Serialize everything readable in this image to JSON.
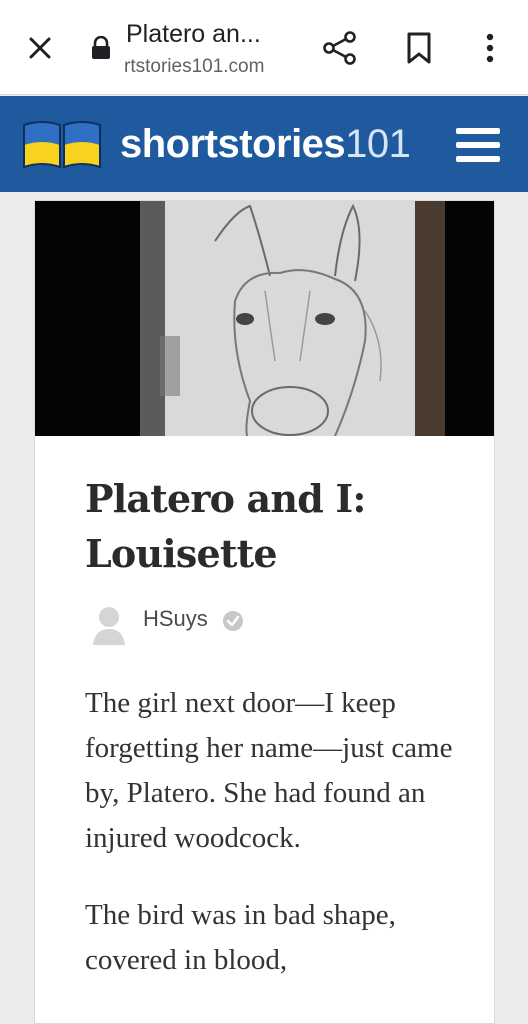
{
  "browser": {
    "page_title": "Platero an...",
    "url": "rtstories101.com",
    "icons": [
      "close-icon",
      "lock-icon",
      "share-icon",
      "bookmark-icon",
      "more-vert-icon"
    ]
  },
  "site": {
    "logo_bold": "shortstories",
    "logo_number": "101",
    "brand_color": "#1f5a9e",
    "logo_colors": [
      "#2f6fc4",
      "#f7d21f"
    ]
  },
  "story": {
    "title_line1": "Platero and I:",
    "title_line2": "Louisette",
    "author": "HSuys",
    "paragraphs": [
      "The girl next door—I keep forgetting her name—just came by, Platero. She had found an injured woodcock.",
      "The bird was in bad shape, covered in blood,"
    ]
  }
}
